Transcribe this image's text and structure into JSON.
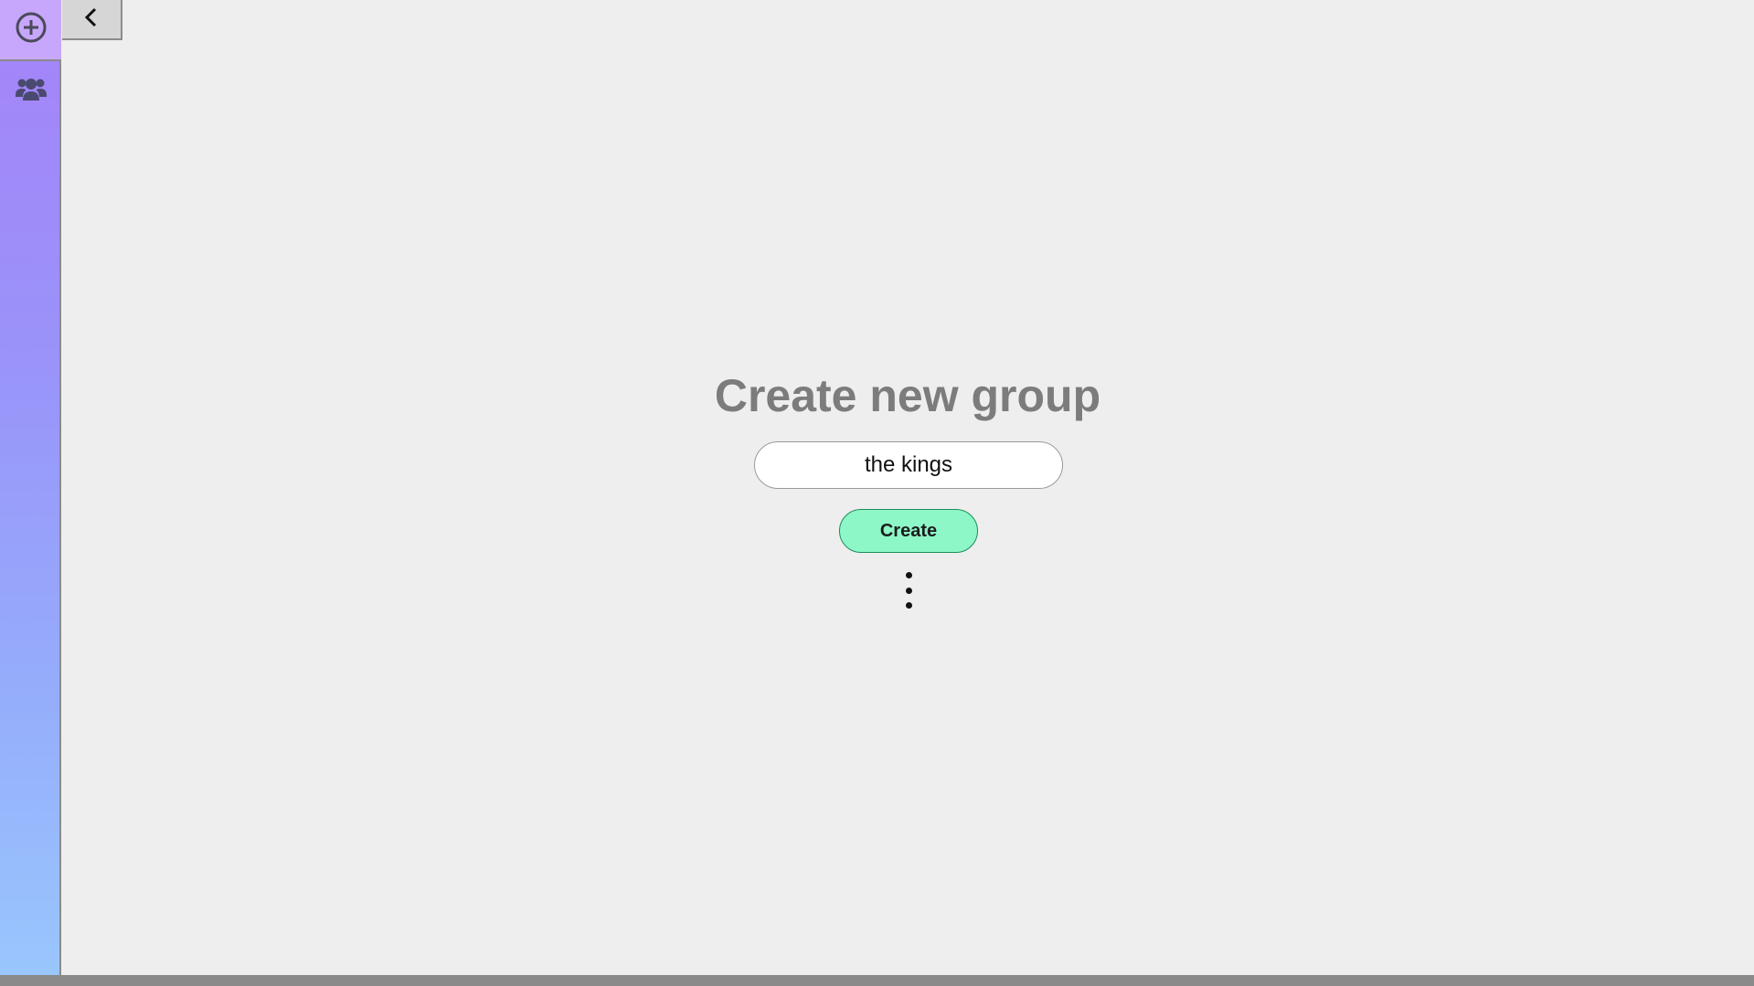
{
  "sidebar": {
    "items": [
      {
        "icon": "plus-circle-icon"
      },
      {
        "icon": "users-icon"
      }
    ]
  },
  "back_button": {
    "icon": "chevron-left-icon"
  },
  "main": {
    "title": "Create new group",
    "group_name_value": "the kings",
    "create_label": "Create",
    "more_icon": "vertical-ellipsis-icon"
  },
  "colors": {
    "sidebar_top": "#a583f9",
    "sidebar_bottom": "#99c6fd",
    "create_button": "#8ef7c8",
    "background": "#eeeeee"
  }
}
